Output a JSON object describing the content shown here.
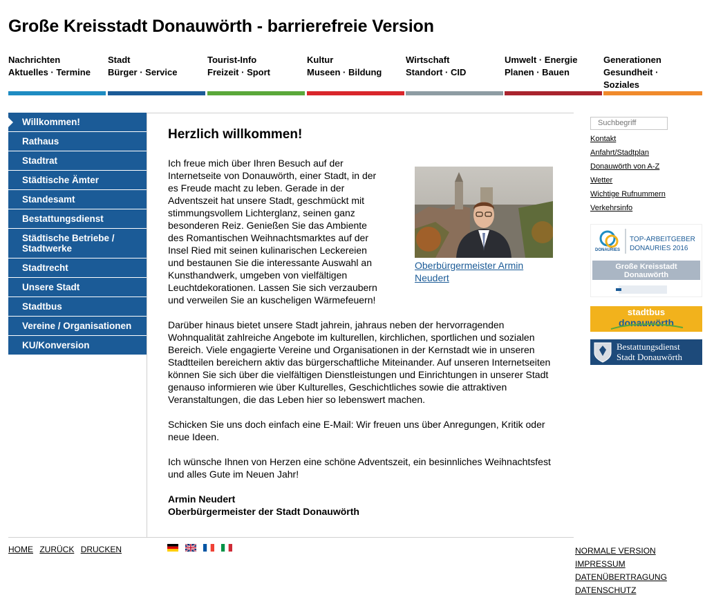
{
  "site": {
    "title": "Große Kreisstadt Donauwörth - barrierefreie Version"
  },
  "topnav": [
    {
      "line1": "Nachrichten",
      "line2": "Aktuelles · Termine",
      "line3": "",
      "color": "#1e8cc2"
    },
    {
      "line1": "Stadt",
      "line2": "Bürger · Service",
      "line3": "",
      "color": "#1b5b97"
    },
    {
      "line1": "Tourist-Info",
      "line2": "Freizeit · Sport",
      "line3": "",
      "color": "#5aa83a"
    },
    {
      "line1": "Kultur",
      "line2": "Museen · Bildung",
      "line3": "",
      "color": "#d9262b"
    },
    {
      "line1": "Wirtschaft",
      "line2": "Standort · CID",
      "line3": "",
      "color": "#8e9ca3"
    },
    {
      "line1": "Umwelt · Energie",
      "line2": "Planen · Bauen",
      "line3": "",
      "color": "#a9242e"
    },
    {
      "line1": "Generationen",
      "line2": "Gesundheit ·",
      "line3": "Soziales",
      "color": "#f08a2b"
    }
  ],
  "sidebar": [
    "Willkommen!",
    "Rathaus",
    "Stadtrat",
    "Städtische Ämter",
    "Standesamt",
    "Bestattungsdienst",
    "Städtische Betriebe / Stadtwerke",
    "Stadtrecht",
    "Unsere Stadt",
    "Stadtbus",
    "Vereine / Organisationen",
    "KU/Konversion"
  ],
  "content": {
    "heading": "Herzlich willkommen!",
    "p1": "Ich freue mich über Ihren Besuch auf der Internetseite von Donauwörth, einer Stadt, in der es Freude macht zu leben. Gerade in der Adventszeit hat unsere Stadt, geschmückt mit stimmungsvollem Lichterglanz, seinen ganz besonderen Reiz. Genießen Sie das Ambiente des Romantischen Weihnachtsmarktes auf der Insel Ried mit seinen kulinarischen Leckereien und bestaunen Sie die interessante Auswahl an Kunsthandwerk, umgeben von vielfältigen Leuchtdekorationen. Lassen Sie sich verzaubern und verweilen Sie an kuscheligen Wärmefeuern!",
    "p2": "Darüber hinaus bietet unsere Stadt jahrein, jahraus neben der hervorragenden Wohnqualität zahlreiche Angebote im kulturellen, kirchlichen, sportlichen und sozialen Bereich. Viele engagierte Vereine und Organisationen in der Kernstadt wie in unseren Stadtteilen bereichern aktiv das bürgerschaftliche Miteinander. Auf unseren Internetseiten können Sie sich über die vielfältigen Dienstleistungen und Einrichtungen in unserer Stadt genauso informieren wie über Kulturelles, Geschichtliches sowie die attraktiven Veranstaltungen, die das Leben hier so lebenswert machen.",
    "p3": "Schicken Sie uns doch einfach eine E-Mail: Wir freuen uns über Anregungen, Kritik oder neue Ideen.",
    "p4": "Ich wünsche Ihnen von Herzen eine schöne Adventszeit, ein besinnliches Weihnachtsfest und alles Gute im Neuen Jahr!",
    "sig_name": "Armin Neudert",
    "sig_title": "Oberbürgermeister der Stadt Donauwörth",
    "photo_caption": "Oberbürgermeister Armin Neudert"
  },
  "right": {
    "search_placeholder": "Suchbegriff",
    "links": [
      "Kontakt",
      "Anfahrt/Stadtplan",
      "Donauwörth von A-Z",
      "Wetter",
      "Wichtige Rufnummern",
      "Verkehrsinfo"
    ],
    "banner_ta": {
      "line1": "TOP-ARBEITGEBER",
      "line2": "DONAURIES 2016",
      "logo": "DONAURIES",
      "city1": "Große Kreisstadt",
      "city2": "Donauwörth"
    },
    "banner_bus": {
      "line1": "stadtbus",
      "line2": "donauwörth"
    },
    "banner_bd": {
      "line1": "Bestattungsdienst",
      "line2": "Stadt Donauwörth"
    }
  },
  "footer": {
    "left": [
      "HOME",
      "ZURÜCK",
      "DRUCKEN"
    ],
    "right": [
      "NORMALE VERSION",
      "IMPRESSUM",
      "DATENÜBERTRAGUNG",
      "DATENSCHUTZ"
    ],
    "flags": [
      "de-flag-icon",
      "gb-flag-icon",
      "fr-flag-icon",
      "it-flag-icon"
    ]
  },
  "colors": {
    "primary": "#1b5b97",
    "link": "#1b5b97",
    "stadtbus": "#f2b21c",
    "bestattung": "#1d4a7a"
  }
}
